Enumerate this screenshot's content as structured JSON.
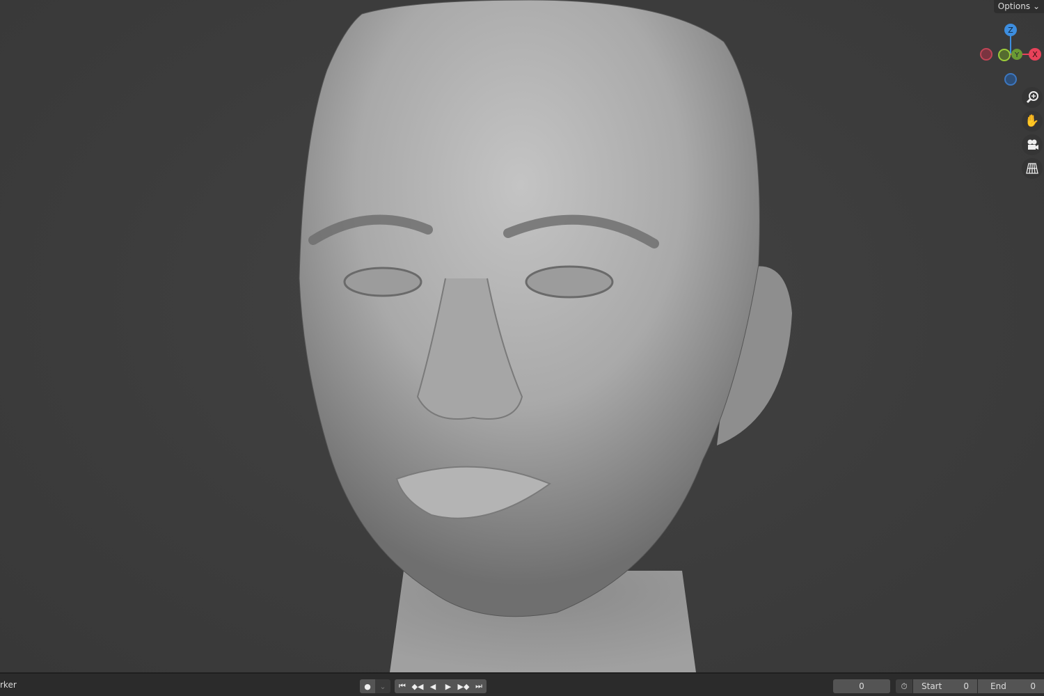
{
  "header": {
    "options_label": "Options"
  },
  "gizmo": {
    "z_label": "Z",
    "y_label": "Y",
    "x_label": "X",
    "colors": {
      "x": "#e8425a",
      "y": "#8bc34a",
      "z": "#3d8ee0"
    }
  },
  "nav_icons": [
    "zoom-icon",
    "pan-hand-icon",
    "camera-icon",
    "perspective-grid-icon"
  ],
  "timeline": {
    "marker_label": "rker",
    "current_frame": "0",
    "start_label": "Start",
    "start_value": "0",
    "end_label": "End",
    "end_value": "0"
  }
}
